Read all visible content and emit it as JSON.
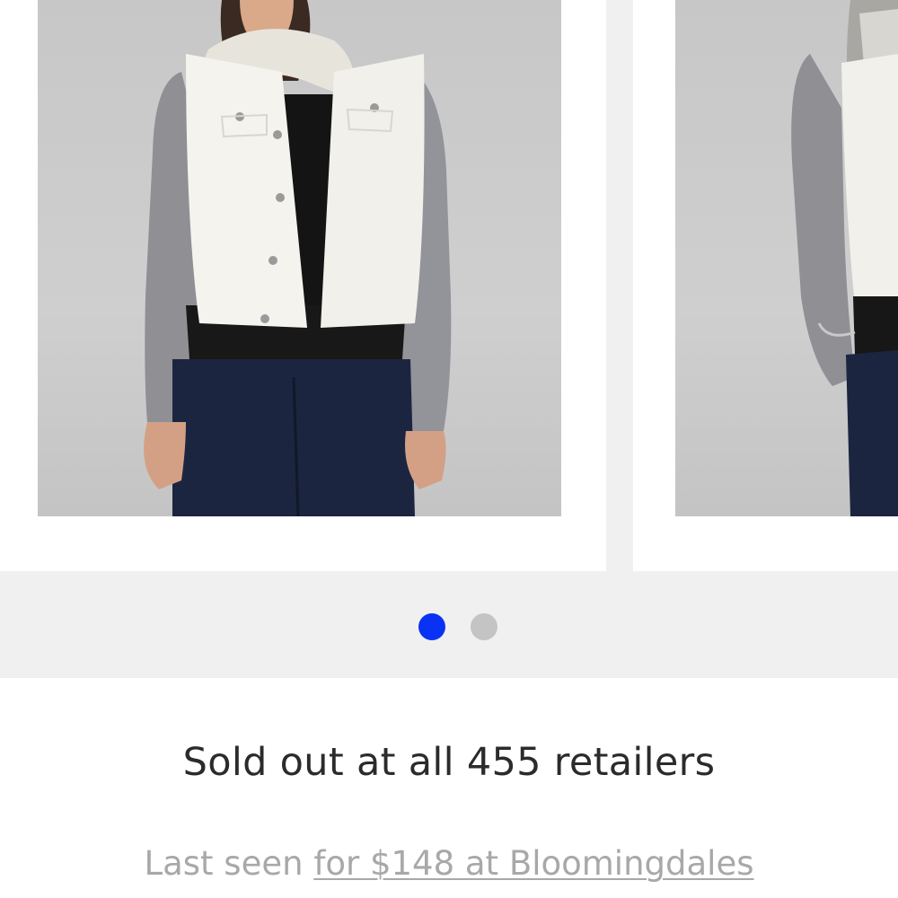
{
  "carousel": {
    "slides": [
      {
        "product_image": "white-denim-jacket-front-model",
        "view": "front"
      },
      {
        "product_image": "white-denim-jacket-side-model",
        "view": "side"
      }
    ],
    "active_index": 0,
    "dot_active_color": "#0a32f5",
    "dot_inactive_color": "#c4c4c4"
  },
  "availability": {
    "headline": "Sold out at all 455 retailers",
    "last_seen_prefix": "Last seen",
    "last_seen_link": "for $148 at Bloomingdales"
  }
}
